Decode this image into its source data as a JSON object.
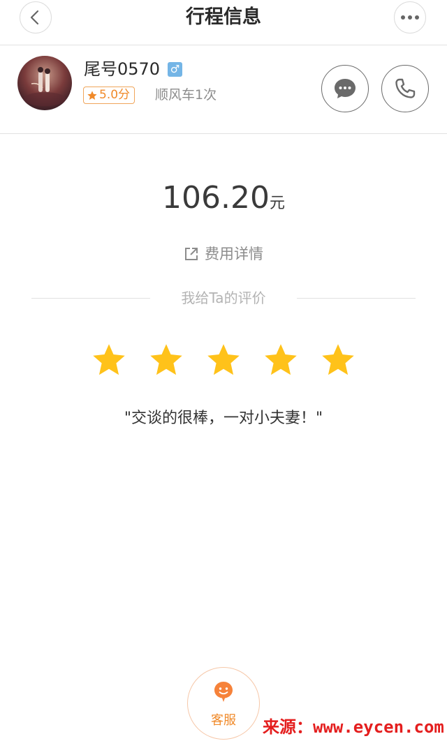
{
  "header": {
    "title": "行程信息",
    "back_icon": "chevron-left-icon",
    "more_icon": "more-horizontal-icon"
  },
  "driver": {
    "name": "尾号0570",
    "gender_symbol": "♂",
    "rating": "5.0分",
    "trip_count": "顺风车1次",
    "chat_icon": "chat-bubble-icon",
    "call_icon": "phone-icon"
  },
  "fare": {
    "amount": "106.20",
    "unit": "元",
    "detail_label": "费用详情"
  },
  "rating_section": {
    "title": "我给Ta的评价",
    "stars": 5,
    "max_stars": 5,
    "comment": "\"交谈的很棒，一对小夫妻！\""
  },
  "customer_service": {
    "label": "客服"
  },
  "watermark": "来源：www.eycen.com",
  "colors": {
    "accent": "#f08a2a",
    "star": "#ffc21a",
    "gender_badge": "#74b5e6",
    "watermark": "#e41e1e"
  }
}
